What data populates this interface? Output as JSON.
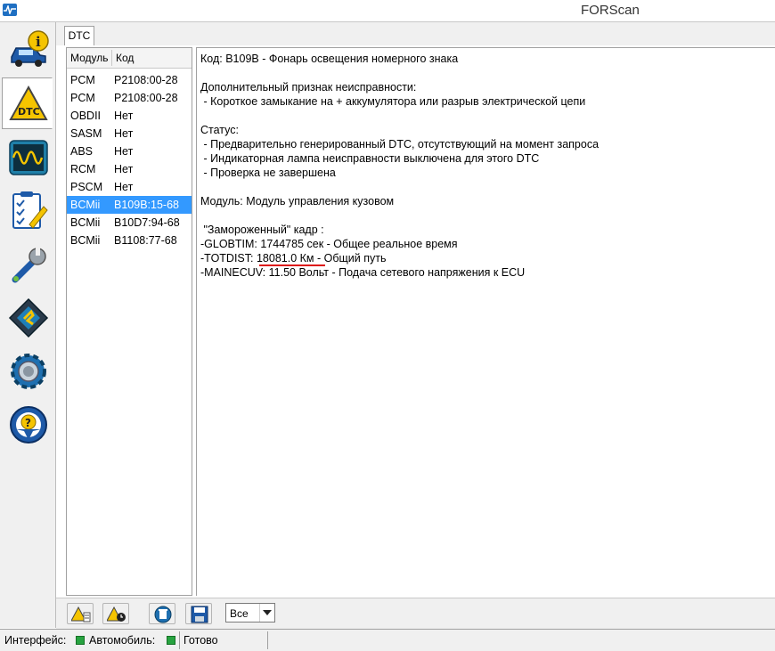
{
  "window": {
    "title": "FORScan"
  },
  "nav": {
    "items": [
      {
        "icon": "car-info-icon"
      },
      {
        "icon": "dtc-warning-icon"
      },
      {
        "icon": "oscilloscope-icon"
      },
      {
        "icon": "checklist-icon"
      },
      {
        "icon": "wrench-icon"
      },
      {
        "icon": "chip-icon"
      },
      {
        "icon": "settings-gear-icon"
      },
      {
        "icon": "help-steering-icon"
      }
    ]
  },
  "tabs": [
    {
      "label": "DTC"
    }
  ],
  "dtc_list": {
    "columns": [
      "Модуль",
      "Код"
    ],
    "rows": [
      {
        "module": "PCM",
        "code": "P2108:00-28"
      },
      {
        "module": "PCM",
        "code": "P2108:00-28"
      },
      {
        "module": "OBDII",
        "code": "Нет"
      },
      {
        "module": "SASM",
        "code": "Нет"
      },
      {
        "module": "ABS",
        "code": "Нет"
      },
      {
        "module": "RCM",
        "code": "Нет"
      },
      {
        "module": "PSCM",
        "code": "Нет"
      },
      {
        "module": "BCMii",
        "code": "B109B:15-68",
        "selected": true
      },
      {
        "module": "BCMii",
        "code": "B10D7:94-68"
      },
      {
        "module": "BCMii",
        "code": "B1108:77-68"
      }
    ]
  },
  "details": {
    "code_line": "Код: B109B - Фонарь освещения номерного знака",
    "extra_heading": "Дополнительный признак неисправности:",
    "extra_line": " - Короткое замыкание на + аккумулятора или разрыв электрической цепи",
    "status_heading": "Статус:",
    "status_1": " - Предварительно генерированный DTC, отсутствующий на момент запроса",
    "status_2": " - Индикаторная лампа неисправности выключена для этого DTC",
    "status_3": " - Проверка не завершена",
    "module_line": "Модуль: Модуль управления кузовом",
    "frame_heading": " \"Замороженный\" кадр :",
    "frame_1": "-GLOBTIM: 1744785 сек - Общее реальное время",
    "frame_2": "-TOTDIST: 18081.0 Км - Общий путь",
    "frame_3": "-MAINECUV: 11.50 Вольт - Подача сетевого напряжения к ECU"
  },
  "toolbar": {
    "filter_value": "Все",
    "buttons": [
      {
        "icon": "read-dtc-icon"
      },
      {
        "icon": "dtc-timer-icon"
      },
      {
        "icon": "clear-dtc-icon"
      },
      {
        "icon": "save-icon"
      }
    ]
  },
  "status": {
    "interface_label": "Интерфейс:",
    "vehicle_label": "Автомобиль:",
    "state_text": "Готово",
    "indicator_color": "#27a340"
  },
  "colors": {
    "selection": "#3399ff",
    "underline": "#dd1111"
  }
}
